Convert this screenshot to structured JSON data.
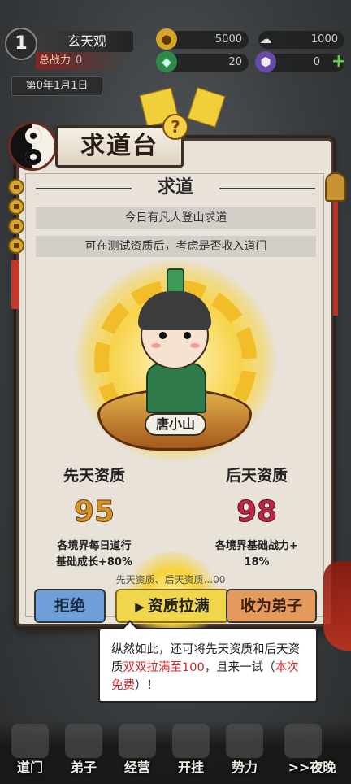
{
  "hud": {
    "level": "1",
    "sect_name": "玄天观",
    "power_label": "总战力",
    "power_value": "0",
    "date": "第0年1月1日",
    "resources": [
      {
        "icon": "gold-coin-icon",
        "value": "5000"
      },
      {
        "icon": "cloud-icon",
        "value": "1000"
      },
      {
        "icon": "jade-icon",
        "value": "20"
      },
      {
        "icon": "purple-crystal-icon",
        "value": "0"
      }
    ]
  },
  "panel": {
    "title": "求道台",
    "help": "?",
    "subtitle": "求道",
    "info_lines": [
      "今日有凡人登山求道",
      "可在测试资质后，考虑是否收入道门"
    ],
    "character_name": "唐小山"
  },
  "aptitude": {
    "innate_label": "先天资质",
    "innate_value": "95",
    "innate_desc": [
      "各境界每日道行",
      "基础成长+80%"
    ],
    "acquired_label": "后天资质",
    "acquired_value": "98",
    "acquired_desc": [
      "各境界基础战力+",
      "18%"
    ],
    "hint": "先天资质、后天资质...00"
  },
  "buttons": {
    "reject": "拒绝",
    "max": "资质拉满",
    "accept": "收为弟子"
  },
  "tooltip": {
    "part1": "纵然如此，还可将先天资质和后天资质",
    "red1": "双双拉满至100",
    "part2": "，且来一试（",
    "red2": "本次免费",
    "part3": "）！"
  },
  "nav": [
    "道门",
    "弟子",
    "经营",
    "开挂",
    "势力",
    ">>夜晚"
  ],
  "colors": {
    "panel_bg": "#e8e2d8",
    "innate_ring": "#5b86d8",
    "acquired_ring": "#b64fd6",
    "tooltip_highlight": "#d3262b",
    "max_button": "#f0d64a"
  }
}
